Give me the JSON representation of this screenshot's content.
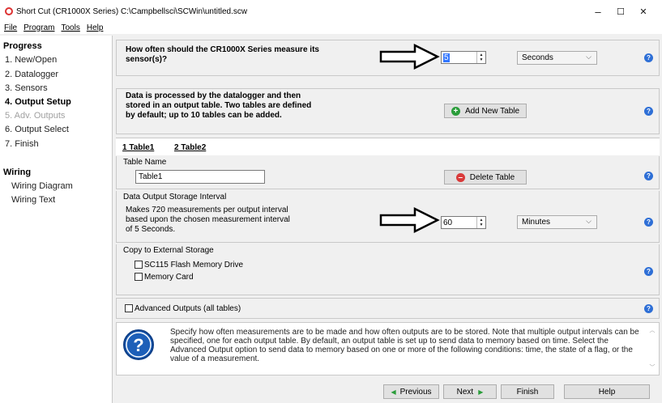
{
  "window": {
    "title": "Short Cut (CR1000X Series) C:\\Campbellsci\\SCWin\\untitled.scw",
    "minimize": "–",
    "maximize": "☐",
    "close": "✕"
  },
  "menu": [
    "File",
    "Program",
    "Tools",
    "Help"
  ],
  "sidebar": {
    "progress_heading": "Progress",
    "steps": [
      "1. New/Open",
      "2. Datalogger",
      "3. Sensors",
      "4. Output Setup",
      "5. Adv. Outputs",
      "6. Output Select",
      "7. Finish"
    ],
    "wiring_heading": "Wiring",
    "wiring_items": [
      "Wiring Diagram",
      "Wiring Text"
    ]
  },
  "measure": {
    "question": "How often should the CR1000X Series measure its sensor(s)?",
    "value": "5",
    "unit": "Seconds"
  },
  "tables_info": {
    "text": "Data is processed by the datalogger and then stored in an output table. Two tables are defined by default; up to 10 tables can be added.",
    "add_button": "Add New Table"
  },
  "tabs": [
    "1 Table1",
    "2 Table2"
  ],
  "table_name": {
    "label": "Table Name",
    "value": "Table1",
    "delete_button": "Delete Table"
  },
  "interval": {
    "label": "Data Output Storage Interval",
    "text": "Makes 720 measurements per output interval based upon the chosen measurement interval of 5 Seconds.",
    "value": "60",
    "unit": "Minutes"
  },
  "external": {
    "label": "Copy to External Storage",
    "opt1": "SC115 Flash Memory Drive",
    "opt2": "Memory Card"
  },
  "advanced": {
    "label": "Advanced Outputs (all tables)"
  },
  "info": {
    "text": "Specify how often measurements are to be made and how often outputs are to be stored. Note that multiple output intervals can be specified, one for each output table. By default, an output table is set up to send data to memory based on time. Select the Advanced Output option to send data to memory based on one or more of the following conditions: time, the state of a flag, or the value of a measurement."
  },
  "footer": {
    "previous": "Previous",
    "next": "Next",
    "finish": "Finish",
    "help": "Help"
  },
  "icons": {
    "help": "?",
    "add": "+",
    "delete": "–",
    "prev": "◀",
    "next": "▶"
  }
}
